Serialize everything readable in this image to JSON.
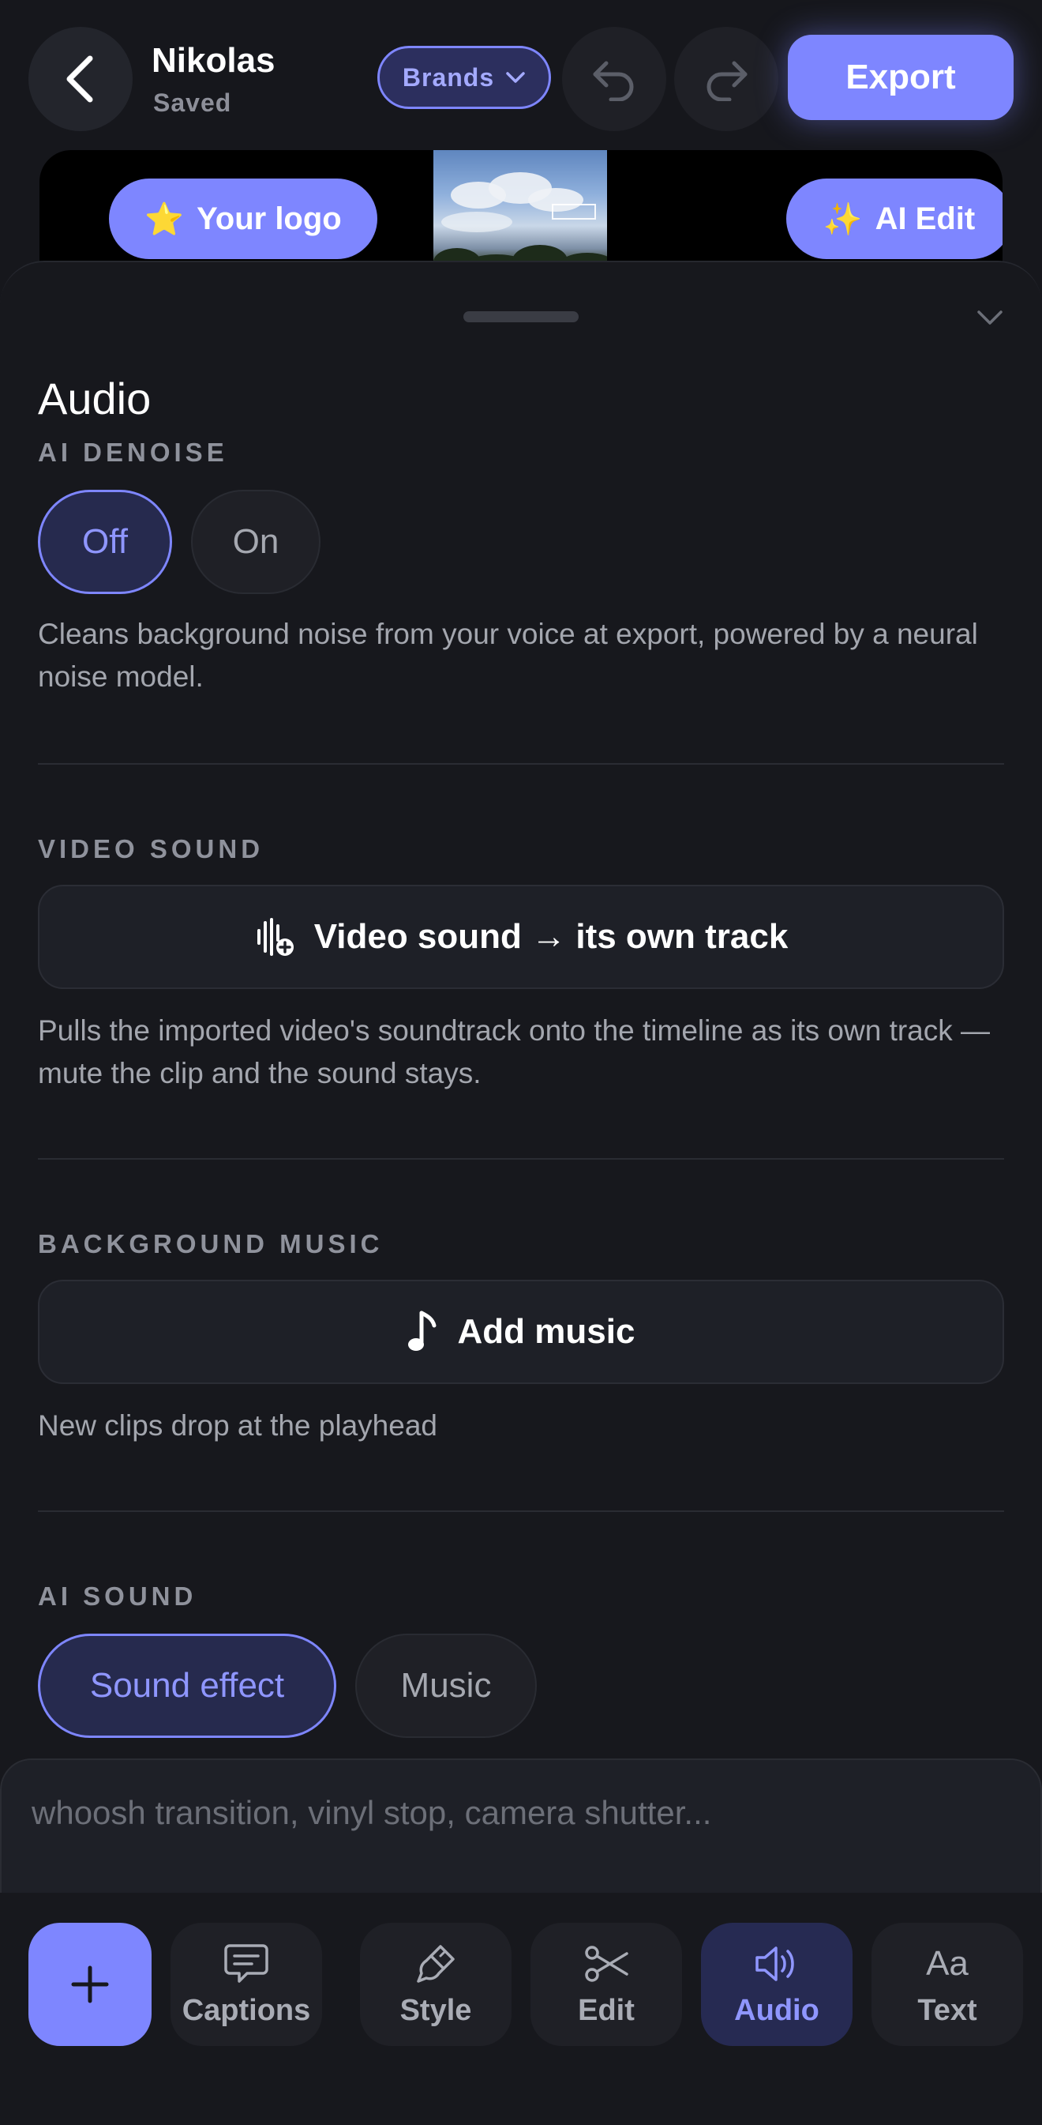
{
  "header": {
    "project_name": "Nikolas",
    "project_status": "Saved",
    "brands_label": "Brands",
    "export_label": "Export"
  },
  "preview": {
    "logo_button": {
      "emoji": "⭐",
      "label": "Your logo"
    },
    "ai_edit_button": {
      "emoji": "✨",
      "label": "AI Edit"
    }
  },
  "audio_panel": {
    "title": "Audio",
    "ai_denoise": {
      "label": "AI DENOISE",
      "options": [
        "Off",
        "On"
      ],
      "selected": "Off",
      "description": "Cleans background noise from your voice at export, powered by a neural noise model."
    },
    "video_sound": {
      "label": "VIDEO SOUND",
      "button_label": "Video sound → its own track",
      "description": "Pulls the imported video's soundtrack onto the timeline as its own track — mute the clip and the sound stays."
    },
    "background_music": {
      "label": "BACKGROUND MUSIC",
      "button_label": "Add music",
      "description": "New clips drop at the playhead"
    },
    "ai_sound": {
      "label": "AI SOUND",
      "options": [
        "Sound effect",
        "Music"
      ],
      "selected": "Sound effect",
      "prompt_placeholder": "whoosh transition, vinyl stop, camera shutter..."
    }
  },
  "bottom_nav": {
    "items": [
      {
        "label": "Captions",
        "icon": "captions-icon"
      },
      {
        "label": "Style",
        "icon": "brush-icon"
      },
      {
        "label": "Edit",
        "icon": "scissors-icon"
      },
      {
        "label": "Audio",
        "icon": "speaker-icon"
      },
      {
        "label": "Text",
        "icon": "text-icon",
        "glyph": "Aa"
      }
    ],
    "active": "Audio"
  },
  "colors": {
    "background": "#16171c",
    "accent": "#7e86ff",
    "accent_text": "#8f96ff",
    "muted_text": "#a3a6ae"
  }
}
